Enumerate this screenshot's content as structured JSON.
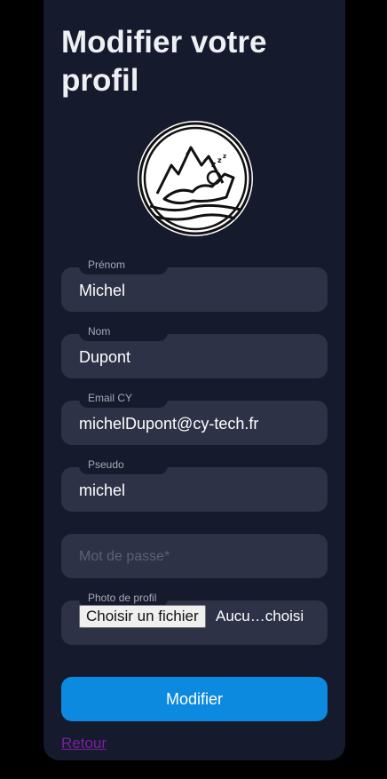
{
  "form": {
    "title": "Modifier votre profil",
    "fields": [
      {
        "label": "Prénom",
        "value": "Michel"
      },
      {
        "label": "Nom",
        "value": "Dupont"
      },
      {
        "label": "Email CY",
        "value": "michelDupont@cy-tech.fr"
      },
      {
        "label": "Pseudo",
        "value": "michel"
      }
    ],
    "password": {
      "placeholder": "Mot de passe*"
    },
    "photo": {
      "label": "Photo de profil",
      "button_label": "Choisir un fichier",
      "status": "Aucu…choisi"
    },
    "submit_label": "Modifier",
    "back_label": "Retour"
  },
  "colors": {
    "page_bg": "#000000",
    "card_bg": "#151a2c",
    "field_bg": "#2e3246",
    "accent": "#0c8ae0",
    "link": "#7b1fa2"
  },
  "icons": {
    "avatar": "sleeping-person-mountains-icon"
  }
}
